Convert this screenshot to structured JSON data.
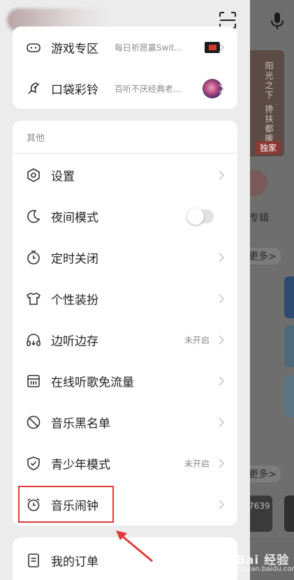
{
  "background": {
    "banner_text": "阳光之下 搀扶都暖",
    "exclusive_badge": "独家",
    "album_label": "专辑",
    "more_label_1": "更多>",
    "more_label_2": "更多>",
    "thumb_number": "7639"
  },
  "top_menu": [
    {
      "label": "游戏专区",
      "promo": "每日祈愿赢Swit...",
      "icon": "gamepad-icon"
    },
    {
      "label": "口袋彩铃",
      "promo": "百听不厌经典老...",
      "icon": "ringtone-icon"
    }
  ],
  "other_section": {
    "title": "其他",
    "items": [
      {
        "label": "设置",
        "icon": "settings-icon"
      },
      {
        "label": "夜间模式",
        "icon": "moon-icon",
        "toggle": false
      },
      {
        "label": "定时关闭",
        "icon": "timer-icon"
      },
      {
        "label": "个性装扮",
        "icon": "shirt-icon"
      },
      {
        "label": "边听边存",
        "icon": "headphones-icon",
        "status": "未开启"
      },
      {
        "label": "在线听歌免流量",
        "icon": "sim-card-icon"
      },
      {
        "label": "音乐黑名单",
        "icon": "block-icon"
      },
      {
        "label": "青少年模式",
        "icon": "shield-icon",
        "status": "未开启"
      },
      {
        "label": "音乐闹钟",
        "icon": "alarm-clock-icon"
      }
    ]
  },
  "bottom_menu": [
    {
      "label": "我的订单",
      "icon": "order-icon"
    }
  ],
  "watermark": {
    "text": "Bai 经验",
    "sub": "jingyan.baidu.com"
  },
  "colors": {
    "highlight": "#e03a3a",
    "card": "#ffffff",
    "drawer_bg": "#ececec"
  }
}
